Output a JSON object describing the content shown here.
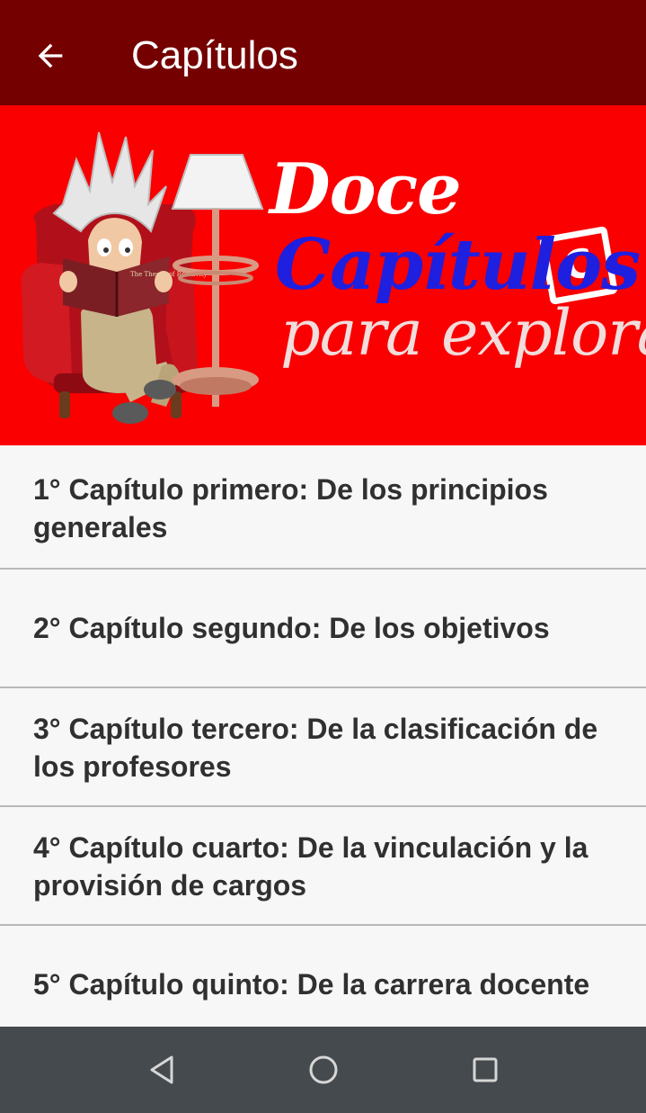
{
  "appbar": {
    "title": "Capítulos",
    "back_icon": "arrow-left-icon",
    "background": "#740000"
  },
  "banner": {
    "line1": "Doce",
    "line2": "Capítulos",
    "line3": "para explorar",
    "logo_letter": "C",
    "book_title": "The Theory of Relativity",
    "background": "#fa0000"
  },
  "chapters": [
    {
      "label": "1° Capítulo primero: De los principios generales"
    },
    {
      "label": "2° Capítulo segundo: De los objetivos"
    },
    {
      "label": "3° Capítulo tercero: De la clasificación de los profesores"
    },
    {
      "label": "4° Capítulo cuarto: De la vinculación y la provisión de cargos"
    },
    {
      "label": "5° Capítulo quinto: De la carrera docente"
    }
  ],
  "navbar": {
    "back_icon": "nav-back-icon",
    "home_icon": "nav-home-icon",
    "recents_icon": "nav-recents-icon",
    "background": "#454a4e"
  }
}
